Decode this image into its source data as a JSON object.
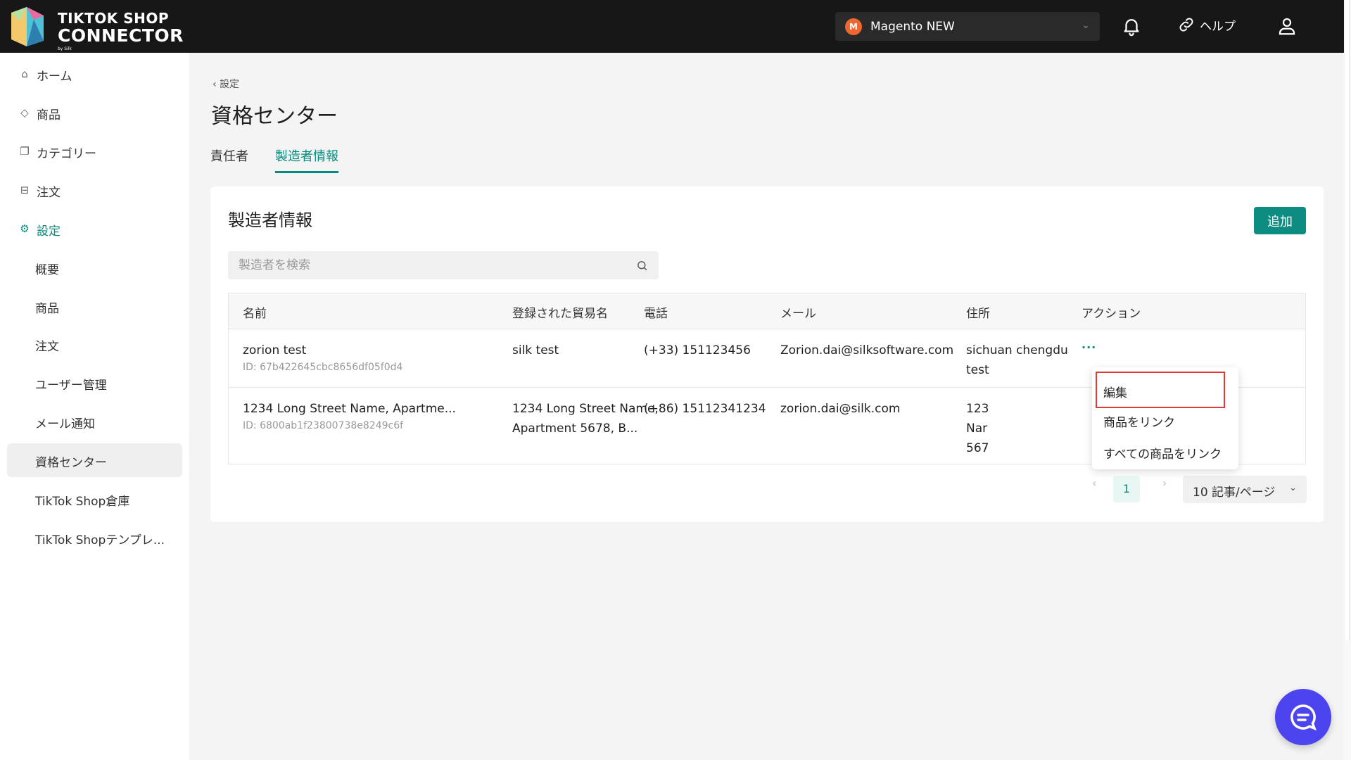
{
  "header": {
    "logo_line1": "TIKTOK SHOP",
    "logo_line2": "CONNECTOR",
    "logo_by": "by Silk",
    "store_name": "Magento NEW",
    "help_label": "ヘルプ"
  },
  "sidebar": {
    "items": [
      {
        "label": "ホーム",
        "icon": "home-icon"
      },
      {
        "label": "商品",
        "icon": "tag-icon"
      },
      {
        "label": "カテゴリー",
        "icon": "copy-icon"
      },
      {
        "label": "注文",
        "icon": "inbox-icon"
      },
      {
        "label": "設定",
        "icon": "gear-icon"
      }
    ],
    "sub_items": [
      {
        "label": "概要"
      },
      {
        "label": "商品"
      },
      {
        "label": "注文"
      },
      {
        "label": "ユーザー管理"
      },
      {
        "label": "メール通知"
      },
      {
        "label": "資格センター"
      },
      {
        "label": "TikTok Shop倉庫"
      },
      {
        "label": "TikTok Shopテンプレ..."
      }
    ]
  },
  "main": {
    "breadcrumb": "設定",
    "title": "資格センター",
    "tabs": [
      {
        "label": "責任者",
        "active": false
      },
      {
        "label": "製造者情報",
        "active": true
      }
    ]
  },
  "card": {
    "title": "製造者情報",
    "add_button": "追加",
    "search_placeholder": "製造者を検索",
    "columns": [
      "名前",
      "登録された貿易名",
      "電話",
      "メール",
      "住所",
      "アクション"
    ],
    "rows": [
      {
        "name": "zorion test",
        "id": "ID: 67b422645cbc8656df05f0d4",
        "trade_name": "silk test",
        "trade_name_2": "",
        "phone": "(+33) 151123456",
        "email": "Zorion.dai@silksoftware.com",
        "address_1": "sichuan chengdu",
        "address_2": "test"
      },
      {
        "name": "1234 Long Street Name, Apartme...",
        "id": "ID: 6800ab1f23800738e8249c6f",
        "trade_name": "1234 Long Street Name,",
        "trade_name_2": "Apartment 5678, B...",
        "phone": "(+86) 15112341234",
        "email": "zorion.dai@silk.com",
        "address_1": "123",
        "address_2": "Nar",
        "address_3": "567"
      }
    ],
    "action_more": "···"
  },
  "pagination": {
    "prev": "‹",
    "page": "1",
    "next": "›",
    "page_size": "10 記事/ページ"
  },
  "action_menu": {
    "items": [
      "編集",
      "商品をリンク",
      "すべての商品をリンク"
    ]
  },
  "colors": {
    "accent": "#078a7e",
    "primary_button": "#0d8c82",
    "topbar": "#171717",
    "chat": "#4b44ef",
    "highlight_border": "#e53935"
  }
}
